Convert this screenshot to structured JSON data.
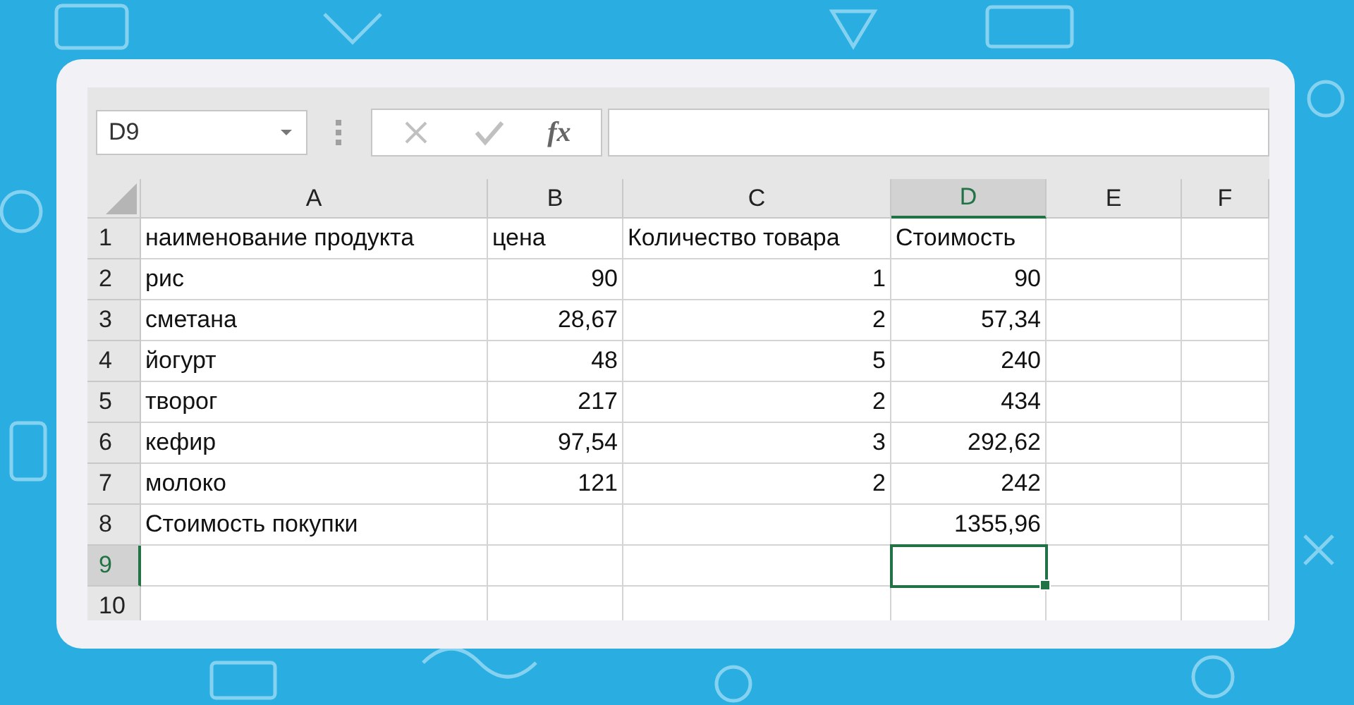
{
  "formula_bar": {
    "name_box": "D9",
    "cancel_disabled": true,
    "enter_disabled": true,
    "function_label": "fx"
  },
  "columns": [
    {
      "label": "A",
      "selected": false
    },
    {
      "label": "B",
      "selected": false
    },
    {
      "label": "C",
      "selected": false
    },
    {
      "label": "D",
      "selected": true
    },
    {
      "label": "E",
      "selected": false
    },
    {
      "label": "F",
      "selected": false
    }
  ],
  "rows": [
    {
      "label": "1",
      "selected": false,
      "cells": [
        {
          "text": "наименование продукта",
          "kind": "text"
        },
        {
          "text": "цена",
          "kind": "text"
        },
        {
          "text": "Количество товара",
          "kind": "text"
        },
        {
          "text": "Стоимость",
          "kind": "text"
        },
        null,
        null
      ]
    },
    {
      "label": "2",
      "selected": false,
      "cells": [
        {
          "text": "рис",
          "kind": "text"
        },
        {
          "text": "90",
          "kind": "number"
        },
        {
          "text": "1",
          "kind": "number"
        },
        {
          "text": "90",
          "kind": "number"
        },
        null,
        null
      ]
    },
    {
      "label": "3",
      "selected": false,
      "cells": [
        {
          "text": "сметана",
          "kind": "text"
        },
        {
          "text": "28,67",
          "kind": "number"
        },
        {
          "text": "2",
          "kind": "number"
        },
        {
          "text": "57,34",
          "kind": "number"
        },
        null,
        null
      ]
    },
    {
      "label": "4",
      "selected": false,
      "cells": [
        {
          "text": "йогурт",
          "kind": "text"
        },
        {
          "text": "48",
          "kind": "number"
        },
        {
          "text": "5",
          "kind": "number"
        },
        {
          "text": "240",
          "kind": "number"
        },
        null,
        null
      ]
    },
    {
      "label": "5",
      "selected": false,
      "cells": [
        {
          "text": "творог",
          "kind": "text"
        },
        {
          "text": "217",
          "kind": "number"
        },
        {
          "text": "2",
          "kind": "number"
        },
        {
          "text": "434",
          "kind": "number"
        },
        null,
        null
      ]
    },
    {
      "label": "6",
      "selected": false,
      "cells": [
        {
          "text": "кефир",
          "kind": "text"
        },
        {
          "text": "97,54",
          "kind": "number"
        },
        {
          "text": "3",
          "kind": "number"
        },
        {
          "text": "292,62",
          "kind": "number"
        },
        null,
        null
      ]
    },
    {
      "label": "7",
      "selected": false,
      "cells": [
        {
          "text": "молоко",
          "kind": "text"
        },
        {
          "text": "121",
          "kind": "number"
        },
        {
          "text": "2",
          "kind": "number"
        },
        {
          "text": "242",
          "kind": "number"
        },
        null,
        null
      ]
    },
    {
      "label": "8",
      "selected": false,
      "cells": [
        {
          "text": "Стоимость покупки",
          "kind": "text"
        },
        null,
        null,
        {
          "text": "1355,96",
          "kind": "number"
        },
        null,
        null
      ]
    },
    {
      "label": "9",
      "selected": true,
      "cells": [
        null,
        null,
        null,
        null,
        null,
        null
      ]
    },
    {
      "label": "10",
      "selected": false,
      "cells": [
        null,
        null,
        null,
        null,
        null,
        null
      ]
    }
  ]
}
